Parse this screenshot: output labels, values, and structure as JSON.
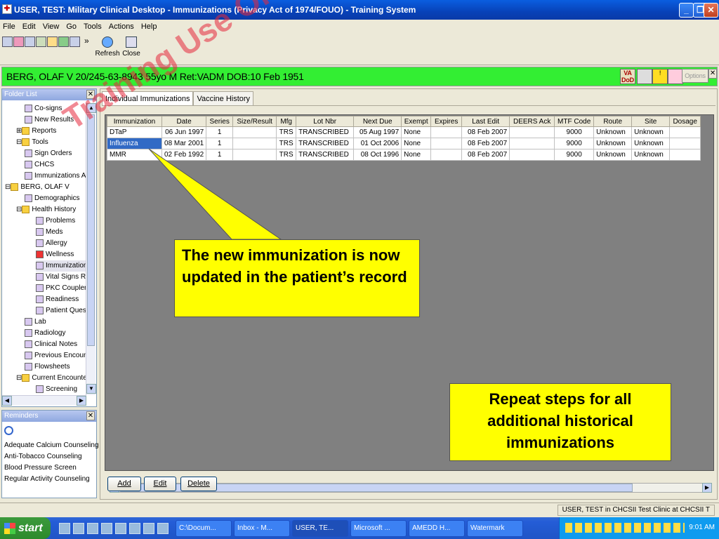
{
  "window": {
    "title": "USER, TEST: Military Clinical Desktop - Immunizations (Privacy Act of 1974/FOUO)  -  Training System",
    "min": "_",
    "max": "❐",
    "close": "✕"
  },
  "menu": [
    "File",
    "Edit",
    "View",
    "Go",
    "Tools",
    "Actions",
    "Help"
  ],
  "toolbar": {
    "overflow": "»",
    "refresh": "Refresh",
    "close": "Close"
  },
  "patient": {
    "banner": "BERG, OLAF V  20/245-63-8943  55yo  M   Ret:VADM  DOB:10 Feb 1951",
    "va_dod_top": "VA",
    "va_dod_bottom": "DoD",
    "options": "Options"
  },
  "folder_list": {
    "title": "Folder List",
    "items": [
      "Co-signs",
      "New Results",
      "Reports",
      "Tools",
      "Sign Orders",
      "CHCS",
      "Immunizations Adm",
      "BERG, OLAF V",
      "Demographics",
      "Health History",
      "Problems",
      "Meds",
      "Allergy",
      "Wellness",
      "Immunizations",
      "Vital Signs Rev",
      "PKC Couplers",
      "Readiness",
      "Patient Questio",
      "Lab",
      "Radiology",
      "Clinical Notes",
      "Previous Encounte",
      "Flowsheets",
      "Current Encounter",
      "Screening"
    ]
  },
  "reminders": {
    "title": "Reminders",
    "items": [
      "Adequate Calcium Counseling",
      "Anti-Tobacco Counseling",
      "Blood Pressure Screen",
      "Regular Activity Counseling"
    ]
  },
  "tabs": [
    "Individual Immunizations",
    "Vaccine History"
  ],
  "grid": {
    "columns": [
      "Immunization",
      "Date",
      "Series",
      "Size/Result",
      "Mfg",
      "Lot Nbr",
      "Next Due",
      "Exempt",
      "Expires",
      "Last Edit",
      "DEERS Ack",
      "MTF Code",
      "Route",
      "Site",
      "Dosage"
    ],
    "rows": [
      [
        "DTaP",
        "06 Jun 1997",
        "1",
        "",
        "TRS",
        "TRANSCRIBED",
        "05 Aug 1997",
        "None",
        "",
        "08 Feb 2007",
        "",
        "9000",
        "Unknown",
        "Unknown",
        ""
      ],
      [
        "Influenza",
        "08 Mar 2001",
        "1",
        "",
        "TRS",
        "TRANSCRIBED",
        "01 Oct 2006",
        "None",
        "",
        "08 Feb 2007",
        "",
        "9000",
        "Unknown",
        "Unknown",
        ""
      ],
      [
        "MMR",
        "02 Feb 1992",
        "1",
        "",
        "TRS",
        "TRANSCRIBED",
        "08 Oct 1996",
        "None",
        "",
        "08 Feb 2007",
        "",
        "9000",
        "Unknown",
        "Unknown",
        ""
      ]
    ],
    "selected_row": 1
  },
  "buttons": {
    "add": "Add",
    "edit": "Edit",
    "delete": "Delete"
  },
  "callouts": {
    "updated": "The new immunization is now updated in the patient’s record",
    "repeat": "Repeat steps for all additional historical immunizations"
  },
  "watermark": "Training Use Only",
  "status": {
    "right": "USER, TEST in CHCSII Test Clinic at CHCSII T"
  },
  "taskbar": {
    "start": "start",
    "tasks": [
      "C:\\Docum...",
      "Inbox - M...",
      "USER, TE...",
      "Microsoft ...",
      "AMEDD H...",
      "Watermark"
    ],
    "clock": "9:01 AM"
  }
}
